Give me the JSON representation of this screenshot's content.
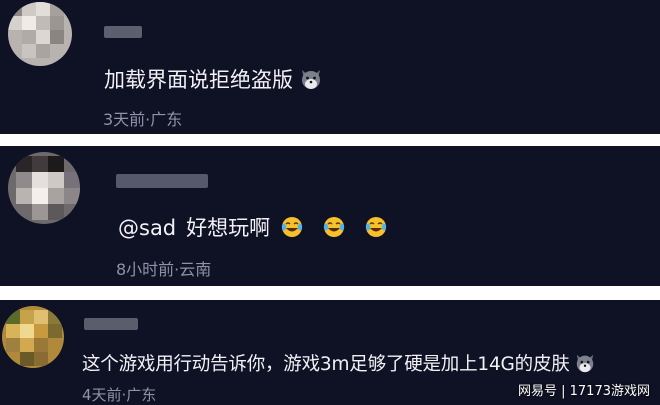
{
  "comments": [
    {
      "text": "加载界面说拒绝盗版",
      "emojis": [
        "wolf-face-emoji"
      ],
      "time": "3天前",
      "location": "广东",
      "meta": "3天前·广东"
    },
    {
      "mention": "@sad",
      "text": "好想玩啊",
      "emojis": [
        "laughing-crying-emoji",
        "laughing-crying-emoji",
        "laughing-crying-emoji"
      ],
      "time": "8小时前",
      "location": "云南",
      "meta": "8小时前·云南"
    },
    {
      "text": "这个游戏用行动告诉你，游戏3m足够了硬是加上14G的皮肤",
      "emojis": [
        "wolf-face-emoji"
      ],
      "time": "4天前",
      "location": "广东",
      "meta": "4天前·广东"
    }
  ],
  "watermark": "网易号 | 17173游戏网",
  "colors": {
    "card_background": "#0f1124",
    "separator": "#ffffff",
    "comment_text": "#f2f2f6",
    "meta_text": "#8e93a6",
    "emoji_yellow": "#f6c12a"
  }
}
